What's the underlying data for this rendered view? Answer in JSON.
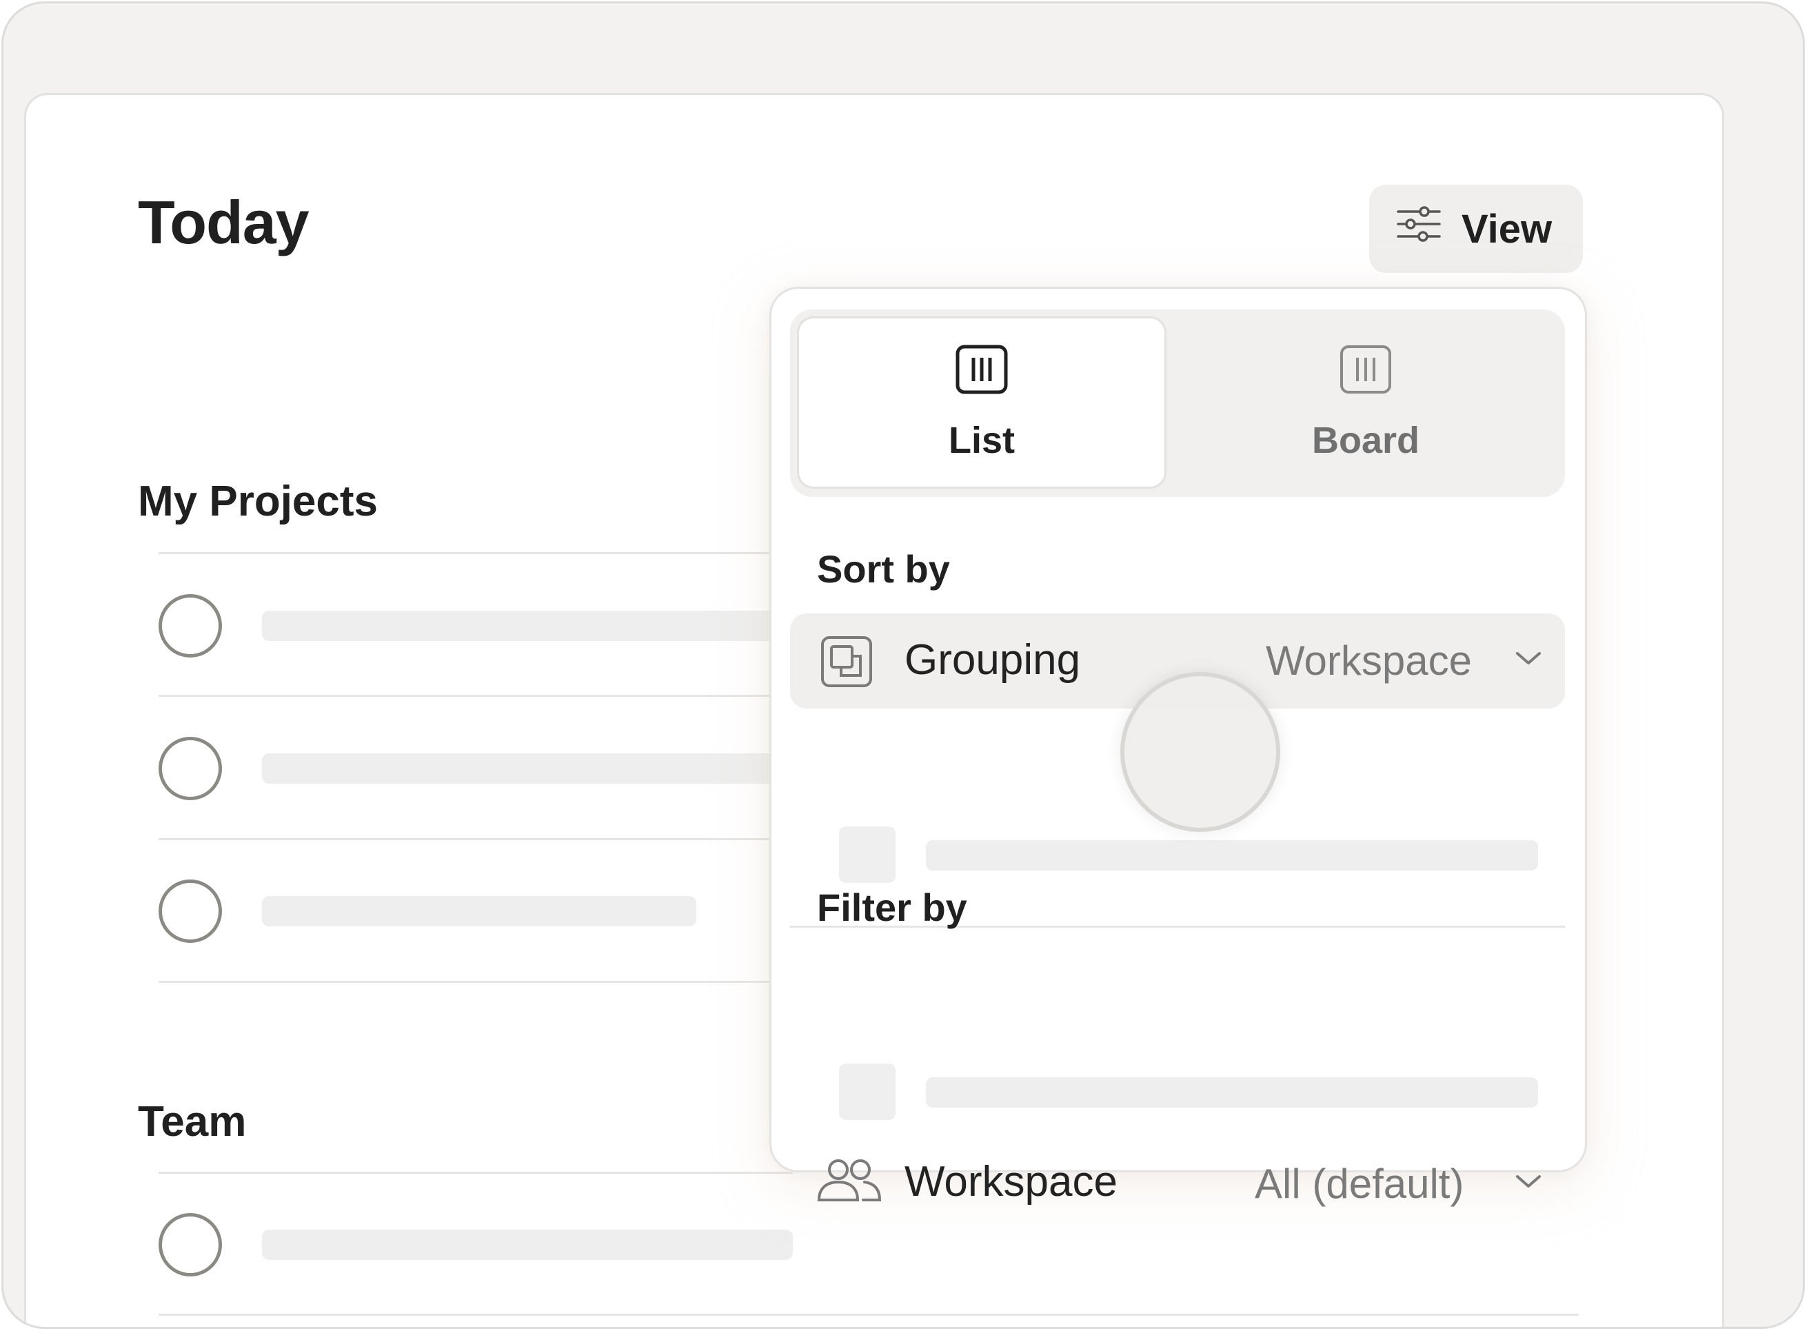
{
  "page": {
    "title": "Today",
    "view_button": "View"
  },
  "sections": [
    {
      "title": "My Projects"
    },
    {
      "title": "Team"
    }
  ],
  "view_panel": {
    "layouts": [
      {
        "label": "List",
        "icon": "list-columns-icon",
        "selected": true
      },
      {
        "label": "Board",
        "icon": "board-columns-icon",
        "selected": false
      }
    ],
    "sort_by": {
      "heading": "Sort by",
      "grouping_label": "Grouping",
      "grouping_value": "Workspace"
    },
    "filter_by": {
      "heading": "Filter by",
      "workspace_label": "Workspace",
      "workspace_value": "All (default)"
    }
  },
  "colors": {
    "background": "#f3f2f1",
    "surface": "#ffffff",
    "text": "#202020",
    "muted": "#7a7a7a",
    "placeholder": "#eeeeee"
  }
}
